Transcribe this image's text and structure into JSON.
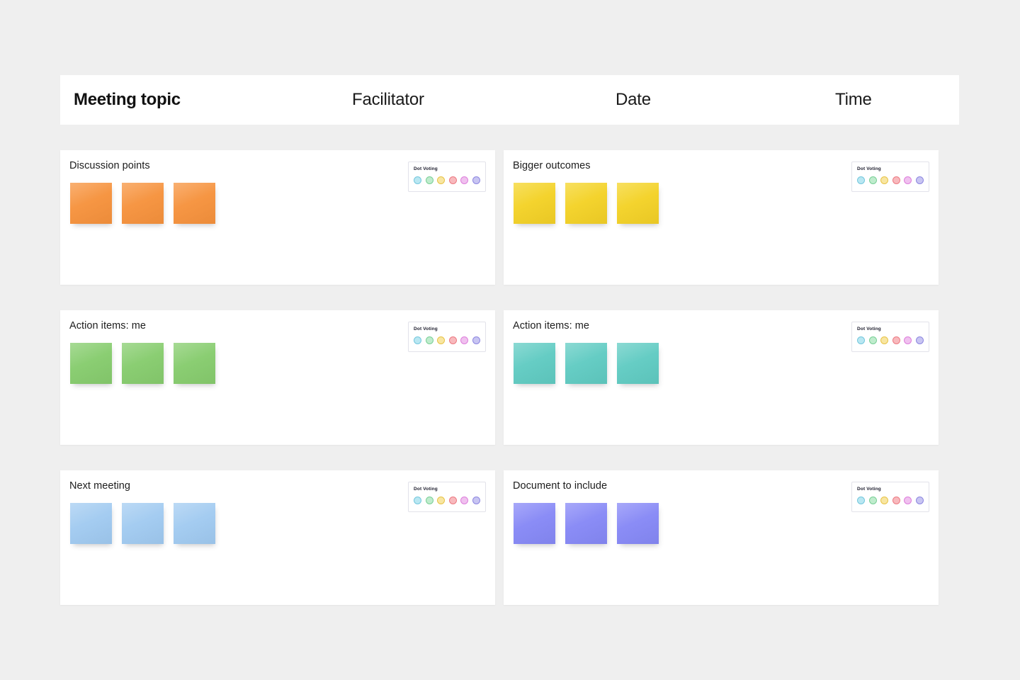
{
  "page": {
    "background_color": "#efefef",
    "card_background": "#ffffff"
  },
  "header": {
    "meeting_topic_label": "Meeting topic",
    "facilitator_label": "Facilitator",
    "date_label": "Date",
    "time_label": "Time"
  },
  "dot_voting": {
    "title": "Dot Voting",
    "dots": [
      {
        "name": "dot-cyan",
        "color": "#b9e7f2",
        "border": "#74c7dd"
      },
      {
        "name": "dot-green",
        "color": "#bfeccd",
        "border": "#79cf96"
      },
      {
        "name": "dot-yellow",
        "color": "#f8e6a2",
        "border": "#e8c347"
      },
      {
        "name": "dot-red",
        "color": "#f8b9bd",
        "border": "#ec7a82"
      },
      {
        "name": "dot-magenta",
        "color": "#f0c1ef",
        "border": "#dd7fdb"
      },
      {
        "name": "dot-purple",
        "color": "#c8c5f2",
        "border": "#8d86e0"
      }
    ]
  },
  "sections": [
    {
      "id": "discussion-points",
      "title": "Discussion points",
      "column": "left",
      "row": 1,
      "note_color": "#f79a4a",
      "note_color_end": "#f5913c",
      "note_count": 3
    },
    {
      "id": "bigger-outcomes",
      "title": "Bigger outcomes",
      "column": "right",
      "row": 1,
      "note_color": "#f5d734",
      "note_color_end": "#f2cf26",
      "note_count": 3
    },
    {
      "id": "action-items-me-left",
      "title": "Action items: me",
      "column": "left",
      "row": 2,
      "note_color": "#8ed077",
      "note_color_end": "#86cb6d",
      "note_count": 3
    },
    {
      "id": "action-items-me-right",
      "title": "Action items: me",
      "column": "right",
      "row": 2,
      "note_color": "#6bcfc7",
      "note_color_end": "#5fcac1",
      "note_count": 3
    },
    {
      "id": "next-meeting",
      "title": "Next meeting",
      "column": "left",
      "row": 3,
      "note_color": "#a9cff2",
      "note_color_end": "#9fc9f0",
      "note_count": 3
    },
    {
      "id": "document-to-include",
      "title": "Document to include",
      "column": "right",
      "row": 3,
      "note_color": "#8f90f7",
      "note_color_end": "#8588f5",
      "note_count": 3
    }
  ]
}
